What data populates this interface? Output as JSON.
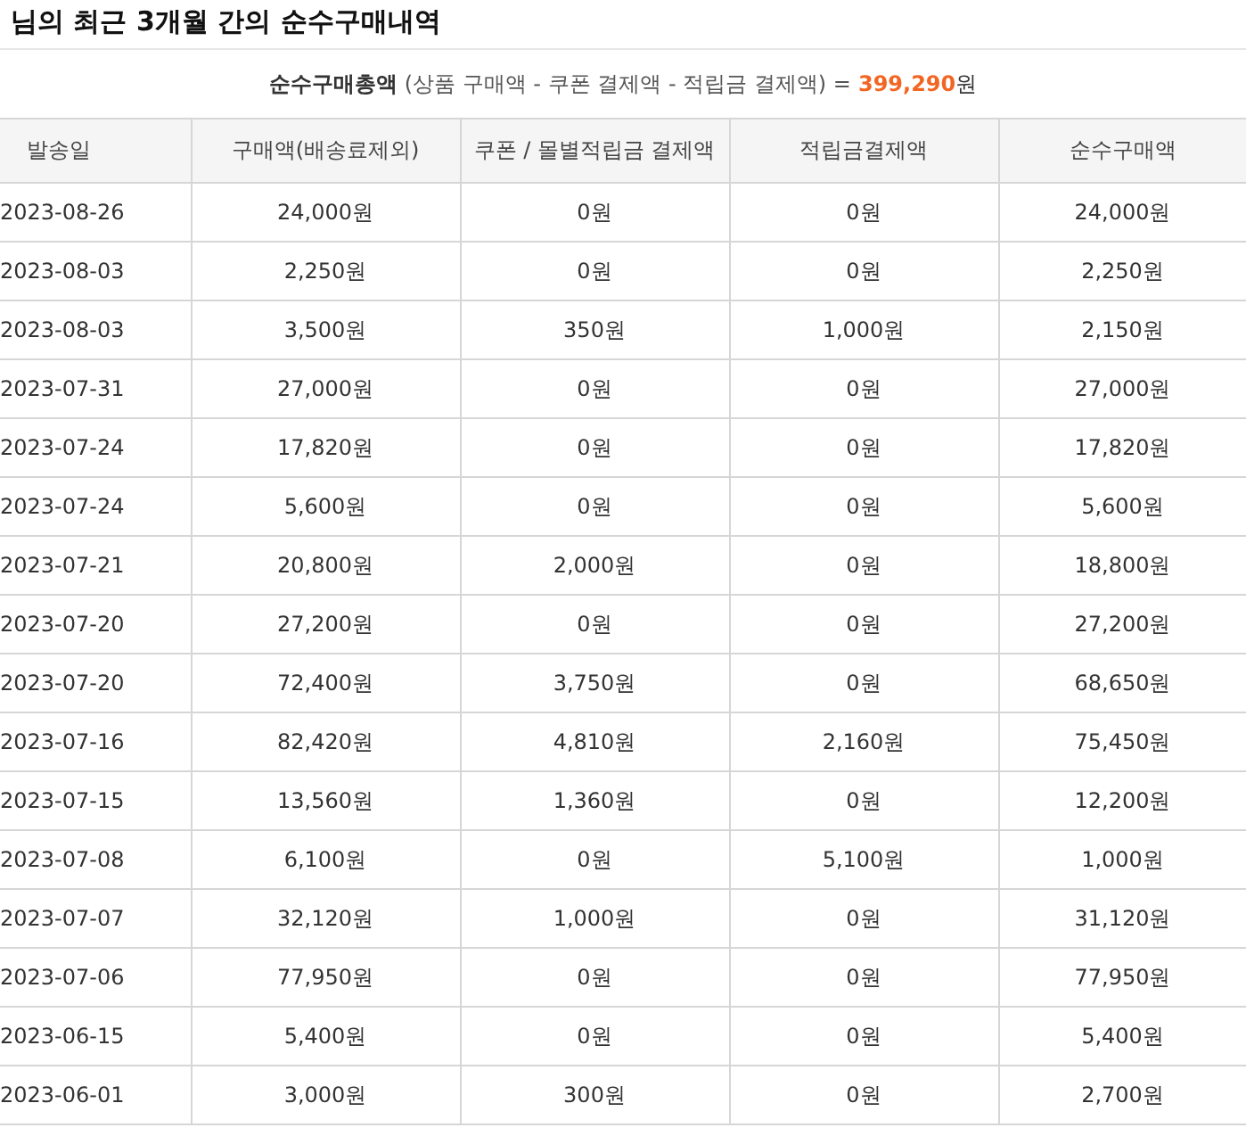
{
  "title": "님의 최근 3개월 간의 순수구매내역",
  "summary": {
    "label": "순수구매총액",
    "formula": "(상품 구매액 - 쿠폰 결제액 - 적립금 결제액) =",
    "amount": "399,290",
    "unit": "원"
  },
  "table": {
    "columns": [
      "발송일",
      "구매액(배송료제외)",
      "쿠폰 / 몰별적립금 결제액",
      "적립금결제액",
      "순수구매액"
    ],
    "rows": [
      [
        "2023-08-26",
        "24,000원",
        "0원",
        "0원",
        "24,000원"
      ],
      [
        "2023-08-03",
        "2,250원",
        "0원",
        "0원",
        "2,250원"
      ],
      [
        "2023-08-03",
        "3,500원",
        "350원",
        "1,000원",
        "2,150원"
      ],
      [
        "2023-07-31",
        "27,000원",
        "0원",
        "0원",
        "27,000원"
      ],
      [
        "2023-07-24",
        "17,820원",
        "0원",
        "0원",
        "17,820원"
      ],
      [
        "2023-07-24",
        "5,600원",
        "0원",
        "0원",
        "5,600원"
      ],
      [
        "2023-07-21",
        "20,800원",
        "2,000원",
        "0원",
        "18,800원"
      ],
      [
        "2023-07-20",
        "27,200원",
        "0원",
        "0원",
        "27,200원"
      ],
      [
        "2023-07-20",
        "72,400원",
        "3,750원",
        "0원",
        "68,650원"
      ],
      [
        "2023-07-16",
        "82,420원",
        "4,810원",
        "2,160원",
        "75,450원"
      ],
      [
        "2023-07-15",
        "13,560원",
        "1,360원",
        "0원",
        "12,200원"
      ],
      [
        "2023-07-08",
        "6,100원",
        "0원",
        "5,100원",
        "1,000원"
      ],
      [
        "2023-07-07",
        "32,120원",
        "1,000원",
        "0원",
        "31,120원"
      ],
      [
        "2023-07-06",
        "77,950원",
        "0원",
        "0원",
        "77,950원"
      ],
      [
        "2023-06-15",
        "5,400원",
        "0원",
        "0원",
        "5,400원"
      ],
      [
        "2023-06-01",
        "3,000원",
        "300원",
        "0원",
        "2,700원"
      ]
    ]
  }
}
